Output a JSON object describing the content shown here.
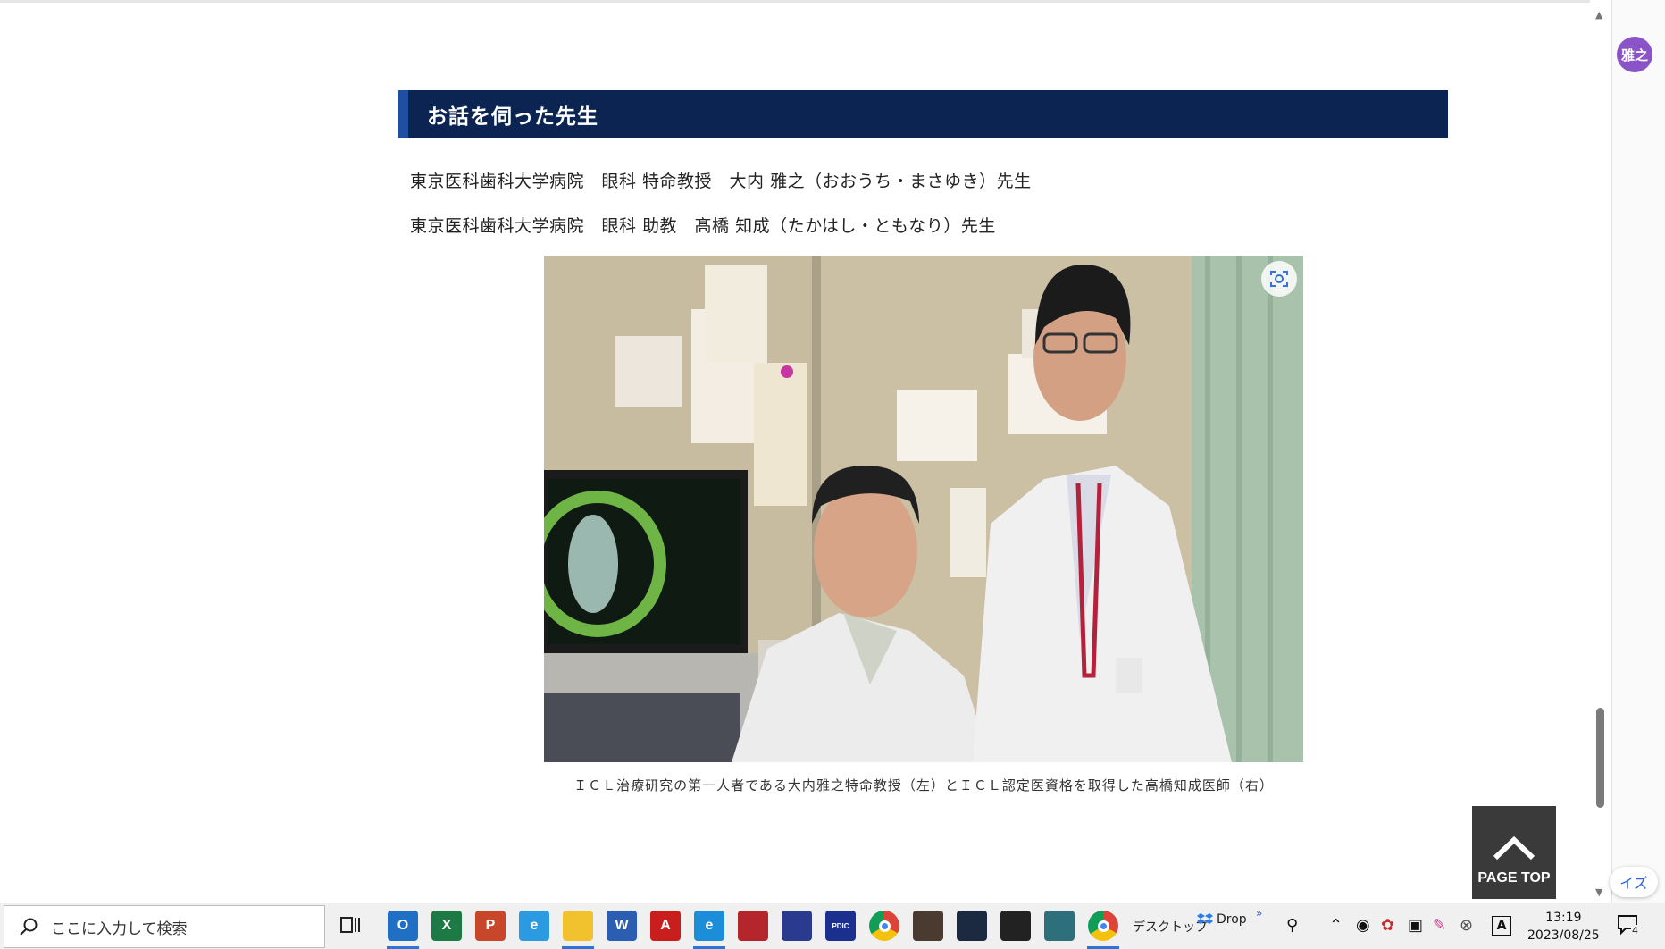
{
  "page": {
    "section_title": "お話を伺った先生",
    "doctors": [
      "東京医科歯科大学病院　眼科 特命教授　大内 雅之（おおうち・まさゆき）先生",
      "東京医科歯科大学病院　眼科 助教　髙橋 知成（たかはし・ともなり）先生"
    ],
    "photo_caption": "ＩＣＬ治療研究の第一人者である大内雅之特命教授（左）とＩＣＬ認定医資格を取得した高橋知成医師（右）",
    "page_top_label": "PAGE TOP"
  },
  "browser": {
    "profile_avatar": "雅之",
    "side_fragment": "イズ"
  },
  "taskbar": {
    "search_placeholder": "ここに入力して検索",
    "desktop_label": "デスクトップ",
    "dropbox_label": "Drop",
    "clock_time": "13:19",
    "clock_date": "2023/08/25",
    "notification_count": "4",
    "apps": [
      {
        "name": "outlook",
        "letter": "O",
        "color": "#1f6fc5"
      },
      {
        "name": "excel",
        "letter": "X",
        "color": "#1e7a44"
      },
      {
        "name": "powerpoint",
        "letter": "P",
        "color": "#c8472a"
      },
      {
        "name": "internet-explorer",
        "letter": "e",
        "color": "#2b9ae0"
      },
      {
        "name": "file-explorer",
        "letter": "",
        "color": "#f2c12e"
      },
      {
        "name": "word",
        "letter": "W",
        "color": "#2b5db0"
      },
      {
        "name": "acrobat",
        "letter": "A",
        "color": "#c81e1e"
      },
      {
        "name": "edge",
        "letter": "e",
        "color": "#1c8dd8"
      },
      {
        "name": "app-red",
        "letter": "",
        "color": "#b4262c"
      },
      {
        "name": "app-arrow",
        "letter": "",
        "color": "#2a3b8f"
      },
      {
        "name": "app-pdic",
        "letter": "PDIC",
        "color": "#1a2f8e"
      },
      {
        "name": "chrome",
        "letter": "",
        "color": "#e0b02a"
      },
      {
        "name": "app-eye",
        "letter": "",
        "color": "#4a3a30"
      },
      {
        "name": "app-dark",
        "letter": "",
        "color": "#1b2a40"
      },
      {
        "name": "sticky-notes",
        "letter": "",
        "color": "#222222"
      },
      {
        "name": "app-monitor",
        "letter": "",
        "color": "#2d6f7a"
      },
      {
        "name": "chrome-profile",
        "letter": "",
        "color": "#e0b02a"
      }
    ]
  }
}
